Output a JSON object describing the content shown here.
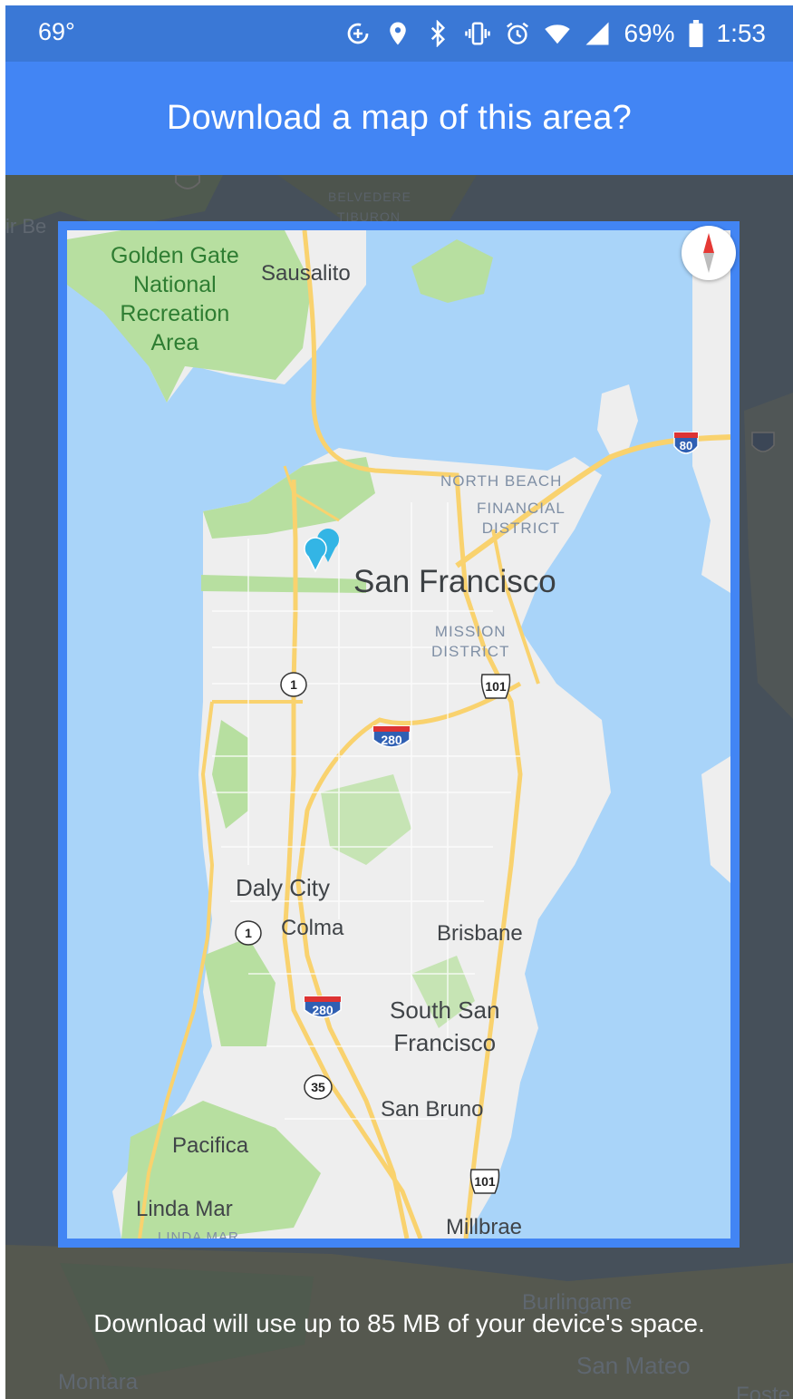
{
  "status_bar": {
    "temperature": "69°",
    "battery": "69%",
    "time": "1:53",
    "icons": [
      "data-saver-icon",
      "location-pin-icon",
      "bluetooth-icon",
      "vibrate-icon",
      "alarm-icon",
      "wifi-icon",
      "signal-icon",
      "battery-icon"
    ]
  },
  "header": {
    "title": "Download a map of this area?"
  },
  "background_labels": {
    "belvedere": "BELVEDERE",
    "tiburon": "TIBURON",
    "muir_beach": "ir Be",
    "burlingame": "Burlingame",
    "san_mateo": "San Mateo",
    "montara": "Montara",
    "foster": "Foste"
  },
  "map_labels": {
    "golden_gate": [
      "Golden Gate",
      "National",
      "Recreation",
      "Area"
    ],
    "sausalito": "Sausalito",
    "north_beach": "NORTH BEACH",
    "financial_district": [
      "FINANCIAL",
      "DISTRICT"
    ],
    "san_francisco": "San Francisco",
    "mission_district": [
      "MISSION",
      "DISTRICT"
    ],
    "daly_city": "Daly City",
    "colma": "Colma",
    "brisbane": "Brisbane",
    "south_san_francisco": [
      "South San",
      "Francisco"
    ],
    "san_bruno": "San Bruno",
    "pacifica": "Pacifica",
    "linda_mar": "Linda Mar",
    "linda_mar_district": "LINDA MAR",
    "millbrae": "Millbrae"
  },
  "route_shields": {
    "i80": "80",
    "i280_north": "280",
    "i280_south": "280",
    "us101_north": "101",
    "us101_south": "101",
    "ca1_north": "1",
    "ca1_south": "1",
    "ca35": "35"
  },
  "footer": {
    "text": "Download will use up to 85 MB of your device's space."
  },
  "colors": {
    "status_bar": "#3a78d6",
    "header": "#4285f4",
    "water": "#a9d4f9",
    "land": "#eeeeee",
    "park": "#b7dfa0",
    "highway": "#f9d26e",
    "dim_overlay": "#46505a"
  }
}
